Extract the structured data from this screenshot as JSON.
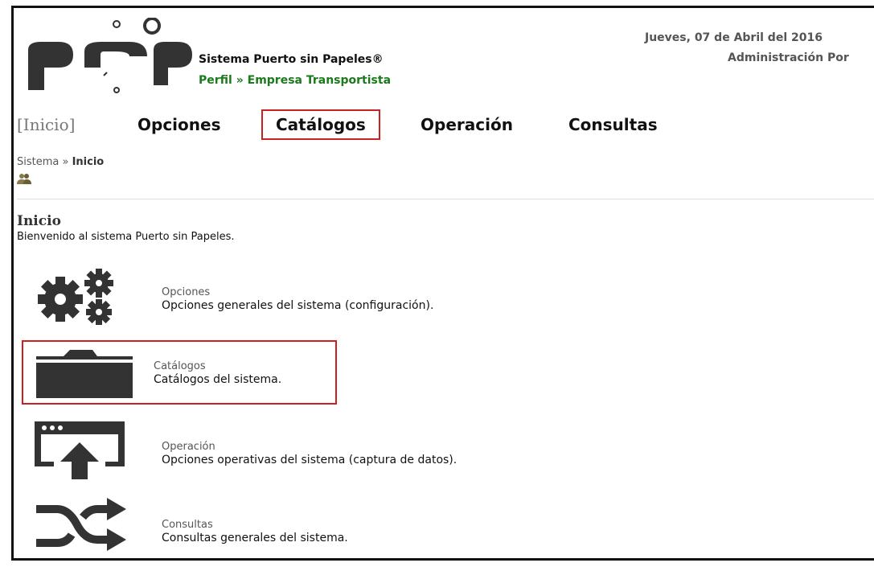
{
  "header": {
    "logo_text": "psp",
    "system_title": "Sistema Puerto sin Papeles®",
    "profile_path": "Perfil » Empresa Transportista",
    "date": "Jueves, 07 de Abril del 2016",
    "admin_label": "Administración Por"
  },
  "menu": {
    "home": "[Inicio]",
    "opciones": "Opciones",
    "catalogos": "Catálogos",
    "operacion": "Operación",
    "consultas": "Consultas"
  },
  "breadcrumb": {
    "root": "Sistema",
    "separator": " » ",
    "current": "Inicio"
  },
  "page": {
    "title": "Inicio",
    "welcome": "Bienvenido al sistema Puerto sin Papeles."
  },
  "sections": [
    {
      "title": "Opciones",
      "description": "Opciones generales del sistema (configuración).",
      "icon": "gears-icon"
    },
    {
      "title": "Catálogos",
      "description": "Catálogos del sistema.",
      "icon": "folder-icon"
    },
    {
      "title": "Operación",
      "description": "Opciones operativas del sistema (captura de datos).",
      "icon": "upload-window-icon"
    },
    {
      "title": "Consultas",
      "description": "Consultas generales del sistema.",
      "icon": "shuffle-icon"
    }
  ],
  "colors": {
    "highlight": "#cc2020",
    "profile_green": "#1b7a1b",
    "icon_dark": "#333333"
  }
}
